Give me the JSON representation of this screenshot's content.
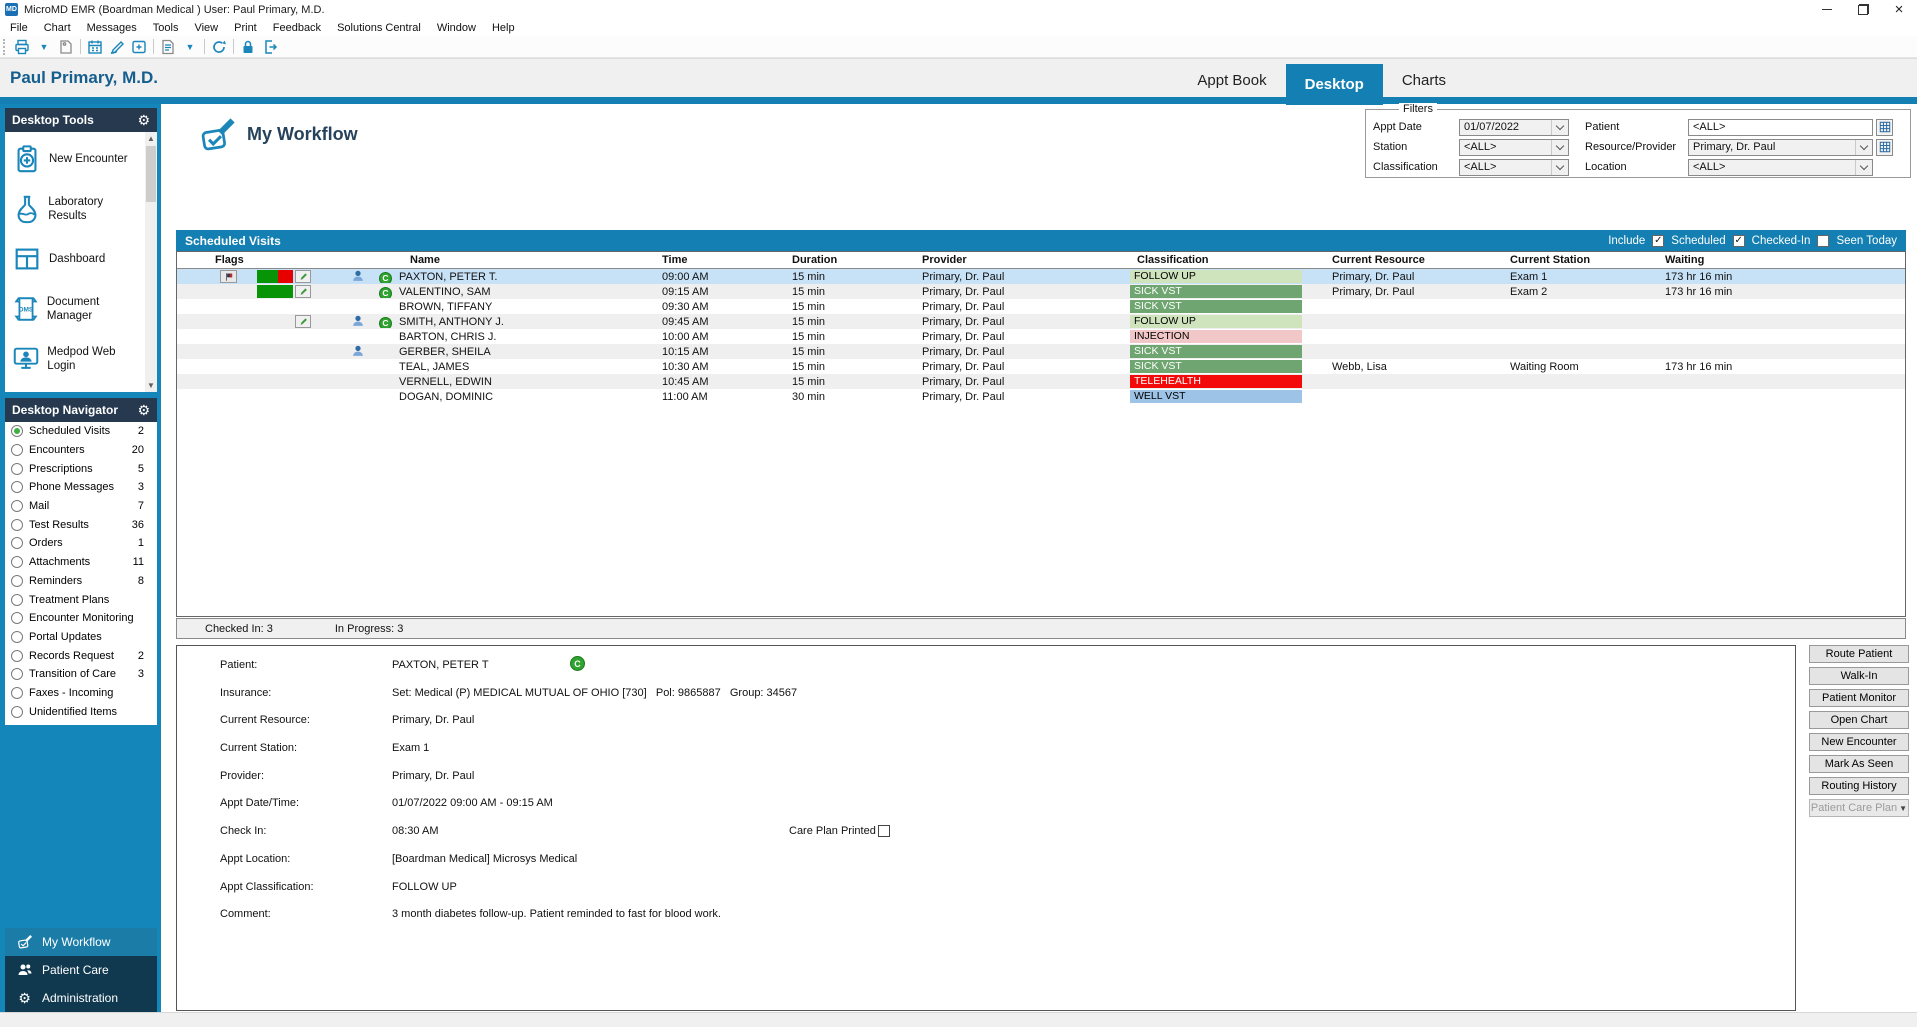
{
  "window": {
    "logo": "MD",
    "title": "MicroMD EMR (Boardman Medical )  User: Paul Primary, M.D."
  },
  "menu": [
    "File",
    "Chart",
    "Messages",
    "Tools",
    "View",
    "Print",
    "Feedback",
    "Solutions Central",
    "Window",
    "Help"
  ],
  "toolbar": [
    {
      "icon": "printer-icon"
    },
    {
      "icon": "dropdown-icon"
    },
    {
      "icon": "tag-icon"
    },
    {
      "sep": true
    },
    {
      "icon": "calendar-icon"
    },
    {
      "icon": "signature-icon"
    },
    {
      "icon": "add-encounter-icon"
    },
    {
      "sep": true
    },
    {
      "icon": "report-icon"
    },
    {
      "icon": "dropdown-icon"
    },
    {
      "sep": true
    },
    {
      "icon": "refresh-icon"
    },
    {
      "sep": true
    },
    {
      "icon": "lock-icon"
    },
    {
      "icon": "exit-icon"
    }
  ],
  "header": {
    "user": "Paul Primary, M.D.",
    "tabs": [
      {
        "label": "Appt Book",
        "active": false
      },
      {
        "label": "Desktop",
        "active": true
      },
      {
        "label": "Charts",
        "active": false
      }
    ]
  },
  "desktop_tools": {
    "title": "Desktop Tools",
    "items": [
      {
        "label": "New Encounter",
        "icon": "new-encounter-icon"
      },
      {
        "label": "Laboratory Results",
        "icon": "laboratory-icon"
      },
      {
        "label": "Dashboard",
        "icon": "dashboard-icon"
      },
      {
        "label": "Document Manager",
        "icon": "document-manager-icon"
      },
      {
        "label": "Medpod Web Login",
        "icon": "medpod-icon"
      }
    ]
  },
  "desktop_navigator": {
    "title": "Desktop Navigator",
    "items": [
      {
        "label": "Scheduled Visits",
        "count": "2",
        "selected": true
      },
      {
        "label": "Encounters",
        "count": "20"
      },
      {
        "label": "Prescriptions",
        "count": "5"
      },
      {
        "label": "Phone Messages",
        "count": "3"
      },
      {
        "label": "Mail",
        "count": "7"
      },
      {
        "label": "Test Results",
        "count": "36"
      },
      {
        "label": "Orders",
        "count": "1"
      },
      {
        "label": "Attachments",
        "count": "11"
      },
      {
        "label": "Reminders",
        "count": "8"
      },
      {
        "label": "Treatment Plans",
        "count": ""
      },
      {
        "label": "Encounter Monitoring",
        "count": ""
      },
      {
        "label": "Portal Updates",
        "count": ""
      },
      {
        "label": "Records Request",
        "count": "2"
      },
      {
        "label": "Transition of Care",
        "count": "3"
      },
      {
        "label": "Faxes - Incoming",
        "count": ""
      },
      {
        "label": "Unidentified Items",
        "count": ""
      }
    ]
  },
  "bottom_nav": [
    {
      "label": "My Workflow",
      "icon": "workflow-stamp-icon",
      "active": true
    },
    {
      "label": "Patient Care",
      "icon": "patient-care-icon",
      "active": false
    },
    {
      "label": "Administration",
      "icon": "administration-gear-icon",
      "active": false
    }
  ],
  "workflow": {
    "title": "My Workflow"
  },
  "filters": {
    "legend": "Filters",
    "rows": [
      [
        {
          "label": "Appt Date",
          "value": "01/07/2022",
          "type": "combo"
        },
        {
          "label": "Patient",
          "value": "<ALL>",
          "type": "input",
          "grid": true
        }
      ],
      [
        {
          "label": "Station",
          "value": "<ALL>",
          "type": "combo"
        },
        {
          "label": "Resource/Provider",
          "value": "Primary, Dr. Paul",
          "type": "combo",
          "grid": true
        }
      ],
      [
        {
          "label": "Classification",
          "value": "<ALL>",
          "type": "combo"
        },
        {
          "label": "Location",
          "value": "<ALL>",
          "type": "combo"
        }
      ]
    ]
  },
  "visits": {
    "title": "Scheduled Visits",
    "include_label": "Include",
    "include": [
      {
        "label": "Scheduled",
        "checked": true
      },
      {
        "label": "Checked-In",
        "checked": true
      },
      {
        "label": "Seen Today",
        "checked": false
      }
    ],
    "columns": [
      "Flags",
      "Name",
      "Time",
      "Duration",
      "Provider",
      "Classification",
      "Current Resource",
      "Current Station",
      "Waiting"
    ],
    "class_styles": {
      "FOLLOW UP": {
        "bg": "#cfe3bd",
        "fg": "#000000"
      },
      "SICK VST": {
        "bg": "#6fa570",
        "fg": "#ffffff"
      },
      "INJECTION": {
        "bg": "#f2c7c7",
        "fg": "#000000"
      },
      "TELEHEALTH": {
        "bg": "#f30b0b",
        "fg": "#ffffff"
      },
      "WELL VST": {
        "bg": "#9dc3e6",
        "fg": "#000000"
      }
    },
    "rows": [
      {
        "name": "PAXTON, PETER T.",
        "time": "09:00 AM",
        "duration": "15 min",
        "provider": "Primary, Dr. Paul",
        "classification": "FOLLOW UP",
        "resource": "Primary, Dr. Paul",
        "station": "Exam 1",
        "waiting": "173 hr 16 min",
        "selected": true,
        "flags": {
          "flag": true,
          "block": "green-red",
          "note": true,
          "person": true,
          "checkedin": true
        }
      },
      {
        "name": "VALENTINO, SAM",
        "time": "09:15 AM",
        "duration": "15 min",
        "provider": "Primary, Dr. Paul",
        "classification": "SICK VST",
        "resource": "Primary, Dr. Paul",
        "station": "Exam 2",
        "waiting": "173 hr 16 min",
        "flags": {
          "block": "green",
          "note": true,
          "checkedin": true
        }
      },
      {
        "name": "BROWN, TIFFANY",
        "time": "09:30 AM",
        "duration": "15 min",
        "provider": "Primary, Dr. Paul",
        "classification": "SICK VST",
        "flags": {}
      },
      {
        "name": "SMITH, ANTHONY J.",
        "time": "09:45 AM",
        "duration": "15 min",
        "provider": "Primary, Dr. Paul",
        "classification": "FOLLOW UP",
        "flags": {
          "note": true,
          "person": true,
          "checkedin": true
        }
      },
      {
        "name": "BARTON, CHRIS J.",
        "time": "10:00 AM",
        "duration": "15 min",
        "provider": "Primary, Dr. Paul",
        "classification": "INJECTION",
        "flags": {}
      },
      {
        "name": "GERBER, SHEILA",
        "time": "10:15 AM",
        "duration": "15 min",
        "provider": "Primary, Dr. Paul",
        "classification": "SICK VST",
        "flags": {
          "person": true
        }
      },
      {
        "name": "TEAL, JAMES",
        "time": "10:30 AM",
        "duration": "15 min",
        "provider": "Primary, Dr. Paul",
        "classification": "SICK VST",
        "resource": "Webb,  Lisa",
        "station": "Waiting Room",
        "waiting": "173 hr 16 min",
        "flags": {}
      },
      {
        "name": "VERNELL, EDWIN",
        "time": "10:45 AM",
        "duration": "15 min",
        "provider": "Primary, Dr. Paul",
        "classification": "TELEHEALTH",
        "flags": {}
      },
      {
        "name": "DOGAN, DOMINIC",
        "time": "11:00 AM",
        "duration": "30 min",
        "provider": "Primary, Dr. Paul",
        "classification": "WELL VST",
        "flags": {}
      }
    ],
    "status": [
      "Checked In: 3",
      "In Progress: 3"
    ]
  },
  "detail": {
    "rows": [
      {
        "label": "Patient:",
        "value": "PAXTON, PETER T",
        "badge": "C"
      },
      {
        "label": "Insurance:",
        "value": "Set: Medical (P) MEDICAL MUTUAL OF OHIO [730]   Pol: 9865887   Group: 34567"
      },
      {
        "label": "Current Resource:",
        "value": "Primary, Dr. Paul"
      },
      {
        "label": "Current Station:",
        "value": "Exam 1"
      },
      {
        "label": "Provider:",
        "value": "Primary, Dr. Paul"
      },
      {
        "label": "Appt Date/Time:",
        "value": "01/07/2022 09:00 AM - 09:15 AM"
      },
      {
        "label": "Check In:",
        "value": "08:30 AM",
        "extra_label": "Care Plan Printed",
        "extra_checked": false
      },
      {
        "label": "Appt Location:",
        "value": "[Boardman Medical] Microsys Medical"
      },
      {
        "label": "Appt Classification:",
        "value": "FOLLOW UP"
      },
      {
        "label": "Comment:",
        "value": "3 month diabetes follow-up. Patient reminded to fast for blood work."
      }
    ]
  },
  "actions": [
    {
      "label": "Route Patient"
    },
    {
      "label": "Walk-In"
    },
    {
      "label": "Patient Monitor"
    },
    {
      "label": "Open Chart"
    },
    {
      "label": "New Encounter"
    },
    {
      "label": "Mark As Seen"
    },
    {
      "label": "Routing History"
    },
    {
      "label": "Patient Care Plan",
      "disabled": true,
      "dropdown": true
    }
  ]
}
